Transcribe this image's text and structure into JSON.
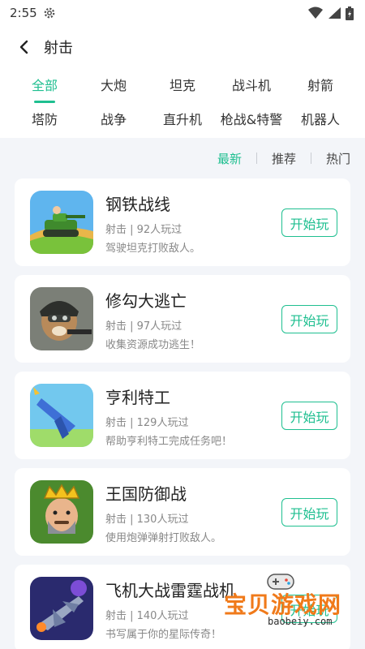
{
  "status_bar": {
    "time": "2:55"
  },
  "header": {
    "title": "射击"
  },
  "categories": [
    {
      "label": "全部",
      "active": true
    },
    {
      "label": "大炮"
    },
    {
      "label": "坦克"
    },
    {
      "label": "战斗机"
    },
    {
      "label": "射箭"
    },
    {
      "label": "塔防"
    },
    {
      "label": "战争"
    },
    {
      "label": "直升机"
    },
    {
      "label": "枪战&特警"
    },
    {
      "label": "机器人"
    }
  ],
  "sort_tabs": [
    {
      "label": "最新",
      "active": true
    },
    {
      "label": "推荐"
    },
    {
      "label": "热门"
    }
  ],
  "games": [
    {
      "name": "钢铁战线",
      "meta": "射击 | 92人玩过",
      "desc": "驾驶坦克打败敌人。",
      "button": "开始玩"
    },
    {
      "name": "修勾大逃亡",
      "meta": "射击 | 97人玩过",
      "desc": "收集资源成功逃生！",
      "button": "开始玩"
    },
    {
      "name": "亨利特工",
      "meta": "射击 | 129人玩过",
      "desc": "帮助亨利特工完成任务吧！",
      "button": "开始玩"
    },
    {
      "name": "王国防御战",
      "meta": "射击 | 130人玩过",
      "desc": "使用炮弹弹射打败敌人。",
      "button": "开始玩"
    },
    {
      "name": "飞机大战雷霆战机",
      "meta": "射击 | 140人玩过",
      "desc": "书写属于你的星际传奇！",
      "button": "开始玩"
    }
  ],
  "watermark": {
    "text": "宝贝游戏网",
    "url": "baobeiy.com"
  },
  "colors": {
    "accent": "#1fbf90",
    "background": "#f3f5f9"
  }
}
